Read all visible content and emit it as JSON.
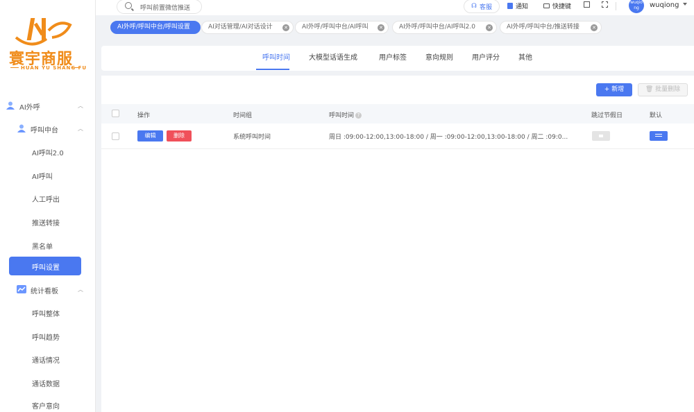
{
  "brand": {
    "name_cn": "寰宇商服",
    "name_en": "HUAN YU SHANG FU",
    "color": "#f08c1a"
  },
  "header": {
    "search_placeholder": "呼叫前置微信推送",
    "kefu_label": "客服",
    "notify_label": "通知",
    "shortcut_label": "快捷键",
    "username": "wuqiong",
    "avatar_text": "wuqio ng"
  },
  "sidebar": {
    "group_ai": "AI外呼",
    "group_call_center": "呼叫中台",
    "items": [
      "AI呼叫2.0",
      "AI呼叫",
      "人工呼出",
      "推送转接",
      "黑名单",
      "呼叫设置"
    ],
    "active_item": "呼叫设置",
    "group_stats": "统计看板",
    "stats_items": [
      "呼叫整体",
      "呼叫趋势",
      "通话情况",
      "通话数据",
      "客户意向"
    ]
  },
  "tags": [
    {
      "label": "AI外呼/呼叫中台/呼叫设置",
      "active": true
    },
    {
      "label": "AI对话管理/AI对话设计",
      "active": false
    },
    {
      "label": "AI外呼/呼叫中台/AI呼叫",
      "active": false
    },
    {
      "label": "AI外呼/呼叫中台/AI呼叫2.0",
      "active": false
    },
    {
      "label": "AI外呼/呼叫中台/推送转接",
      "active": false
    }
  ],
  "tabs": [
    "呼叫时间",
    "大模型话语生成",
    "用户标签",
    "意向规则",
    "用户评分",
    "其他"
  ],
  "active_tab": "呼叫时间",
  "toolbar": {
    "new_label": "新增",
    "batch_delete_label": "批量删除"
  },
  "table": {
    "columns": {
      "action": "操作",
      "time_group": "时间组",
      "call_time": "呼叫时间",
      "skip_holiday": "跳过节假日",
      "default": "默认"
    },
    "rows": [
      {
        "edit": "编辑",
        "delete": "删除",
        "time_group": "系统呼叫时间",
        "call_time": "周日 :09:00-12:00,13:00-18:00 / 周一 :09:00-12:00,13:00-18:00 / 周二 :09:0..."
      }
    ]
  },
  "colors": {
    "primary": "#4a78f0",
    "danger": "#f0505a"
  }
}
